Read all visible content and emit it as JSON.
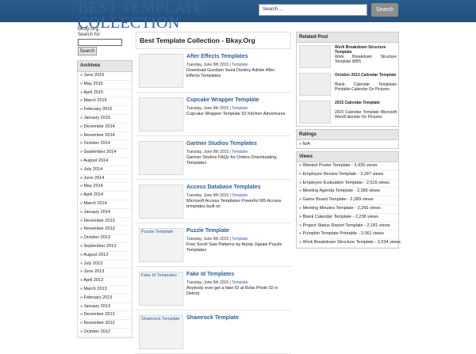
{
  "header": {
    "title_line1": "BEST TEMPLATE",
    "title_line2": "COLLECTION",
    "subtitle": "bkay.org",
    "search_placeholder": "Search ...",
    "search_button": "Search"
  },
  "sidebar": {
    "search_label": "Search for:",
    "search_button": "Search",
    "archives_title": "Archives",
    "archives": [
      "» June 2015",
      "» May 2015",
      "» April 2015",
      "» March 2015",
      "» February 2015",
      "» January 2015",
      "» December 2014",
      "» November 2014",
      "» October 2014",
      "» September 2014",
      "» August 2014",
      "» July 2014",
      "» June 2014",
      "» May 2014",
      "» April 2014",
      "» March 2014",
      "» January 2014",
      "» December 2013",
      "» November 2013",
      "» October 2013",
      "» September 2013",
      "» August 2013",
      "» July 2013",
      "» June 2013",
      "» April 2013",
      "» March 2013",
      "» February 2013",
      "» January 2013",
      "» December 2012",
      "» November 2012",
      "» October 2012"
    ]
  },
  "main": {
    "title": "Best Template Collection - Bkay.Org",
    "posts": [
      {
        "title": "After Effects Templates",
        "date": "Tuesday, June 9th 2015 |",
        "cat": "Template",
        "excerpt": "Download Gundam Seed Destiny Adobe After Effects Templates",
        "thumb": ""
      },
      {
        "title": "Cupcake Wrapper Template",
        "date": "Tuesday, June 9th 2015 |",
        "cat": "Template",
        "excerpt": "Cupcake Wrapper Template 52 Kitchen Adventures",
        "thumb": ""
      },
      {
        "title": "Gartner Studios Templates",
        "date": "Tuesday, June 9th 2015 |",
        "cat": "Template",
        "excerpt": "Gartner Studios FAQs for Orders Downloading Templates",
        "thumb": ""
      },
      {
        "title": "Access Database Templates",
        "date": "Tuesday, June 9th 2015 |",
        "cat": "Template",
        "excerpt": "Microsoft Access Templates Powerful MS Access templates built on",
        "thumb": ""
      },
      {
        "title": "Puzzle Template",
        "date": "Tuesday, June 9th 2015 |",
        "cat": "Template",
        "excerpt": "Free Scroll Saw Patterns by Arpop Jigsaw Puzzle Templates",
        "thumb": "Puzzle Template"
      },
      {
        "title": "Fake Id Templates",
        "date": "Tuesday, June 9th 2015 |",
        "cat": "Template",
        "excerpt": "Anybody ever get a fake ID at Bobs Photo ID in Detroit",
        "thumb": "Fake Id Templates"
      },
      {
        "title": "Shamrock Template",
        "date": "",
        "cat": "",
        "excerpt": "",
        "thumb": "Shamrock Template"
      }
    ]
  },
  "right": {
    "related_title": "Related Post",
    "related": [
      {
        "title": "Work Breakdown Structure Template",
        "desc": "Work Breakdown Structure Template WBS"
      },
      {
        "title": "October 2013 Calendar Template",
        "desc": "Blank Calendar Templates Printable Calendar On Pictures"
      },
      {
        "title": "2015 Calendar Template",
        "desc": "2015 Calendar Template Microsoft WordCalendar On Pictures"
      }
    ],
    "ratings_title": "Ratings",
    "ratings_value": "» N/A",
    "views_title": "Views",
    "views": [
      "» Wanted Poster Template - 3,439 views",
      "» Employee Review Template - 3,247 views",
      "» Employee Evaluation Template - 2,615 views",
      "» Meeting Agenda Template - 2,380 views",
      "» Game Board Template - 2,289 views",
      "» Meeting Minutes Template - 2,265 views",
      "» Blank Calendar Template - 2,238 views",
      "» Project Status Report Template - 2,181 views",
      "» Pumpkin Template Printable - 2,061 views",
      "» Work Breakdown Structure Template - 2,034 views"
    ]
  }
}
